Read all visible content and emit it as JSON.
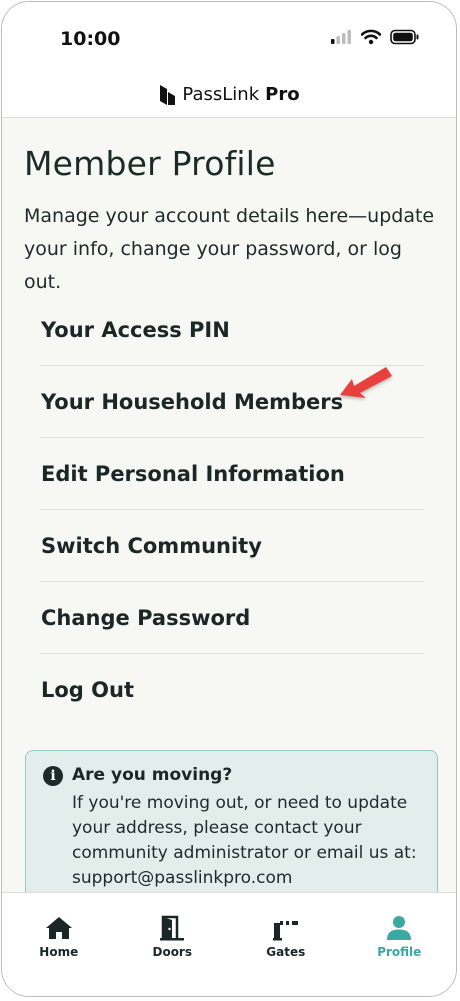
{
  "status_bar": {
    "time": "10:00"
  },
  "header": {
    "brand_name": "PassLink",
    "brand_suffix": "Pro"
  },
  "page": {
    "title": "Member Profile",
    "description": "Manage your account details here—update your info, change your password, or log out."
  },
  "menu": [
    {
      "label": "Your Access PIN"
    },
    {
      "label": "Your Household Members"
    },
    {
      "label": "Edit Personal Information"
    },
    {
      "label": "Switch Community"
    },
    {
      "label": "Change Password"
    },
    {
      "label": "Log Out"
    }
  ],
  "info_box": {
    "icon": "info-icon",
    "title": "Are you moving?",
    "body": "If you're moving out, or need to update your address, please contact your community administrator or email us at: support@passlinkpro.com"
  },
  "tabs": [
    {
      "label": "Home",
      "icon": "home-icon"
    },
    {
      "label": "Doors",
      "icon": "door-icon"
    },
    {
      "label": "Gates",
      "icon": "gate-icon"
    },
    {
      "label": "Profile",
      "icon": "person-icon",
      "active": true
    }
  ],
  "colors": {
    "accent": "#3aa9a4",
    "info_bg": "#e3eeec",
    "info_border": "#95c8c4",
    "arrow": "#e8413c"
  }
}
